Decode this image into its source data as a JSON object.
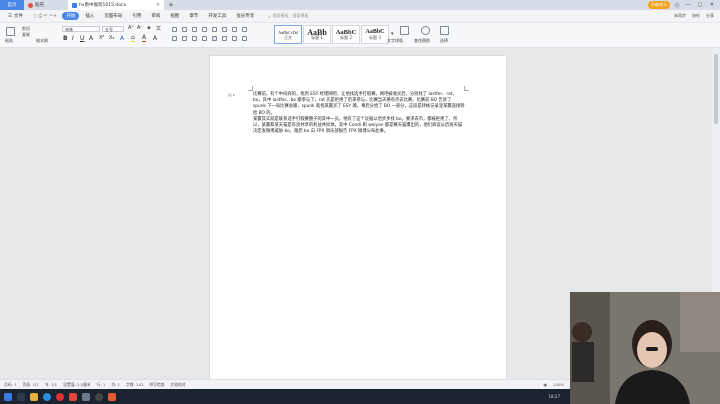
{
  "titlebar": {
    "tabs": [
      {
        "label": "首页"
      },
      {
        "label": "稻壳"
      },
      {
        "label": "hx南中猴狗1015.docx"
      }
    ],
    "upgrade_label": "升级领卡",
    "win_controls": [
      "—",
      "□",
      "✕"
    ]
  },
  "menubar": {
    "file_label": "三 文件",
    "items": [
      "开始",
      "插入",
      "页面布局",
      "引用",
      "审阅",
      "视图",
      "章节",
      "开发工具",
      "会员专享"
    ],
    "active_item": "开始",
    "search_placeholder": "搜索模板、搜索模板",
    "right": [
      "未同步",
      "协作",
      "分享"
    ]
  },
  "ribbon": {
    "paste_label": "粘贴",
    "clip": [
      "剪切",
      "复制",
      "格式刷"
    ],
    "font_name": "宋体",
    "font_size": "五号",
    "styles": [
      {
        "preview": "AaBbCcDd",
        "name": "正文"
      },
      {
        "preview": "AaBb",
        "name": "标题 1"
      },
      {
        "preview": "AaBbC",
        "name": "标题 2"
      },
      {
        "preview": "AaBbC",
        "name": "标题 3"
      }
    ],
    "text_tools": "文字排版",
    "find_replace": "查找替换",
    "select": "选择"
  },
  "document": {
    "paragraphs": [
      "比赛前，有个中间商的，找到 ESY 经理网吧，让他找选手打假赛，网吧被收买后，分别找了 lastfer、rat、bo，其中 lastfer、bo 都参与了，rat 先是拒绝了后来参与，比赛当天猜有点去比赛，比赛前 BO 告诉了 spunk 下一局比赛会输，spunk 就找某赢买了 ESY 输，事后分给了 BO 一部分，这段是转帐记录里某赢直接转给 BO 的。",
      "某赢其实就是联系选手打假赛圈子的其中一员，他有了这个证据以后步步找 bo，要求去市，都被拒绝了，所以，某赢和某天猫是有良共享的利益共同体，其中 Condi 和 weiyan 都是赛天猫爆出的，他们商议以后再天猫决定发微博威胁 bo，随后 bo 向 FPX 俱乐部报告 FPX 微博公布此事。"
    ]
  },
  "statusbar": {
    "left": [
      "页码: 1",
      "页面: 1/1",
      "节: 1/1",
      "设置值: 2.5厘米",
      "行: 1",
      "列: 1",
      "字数: 243",
      "拼写检查",
      "文档校对"
    ],
    "zoom": "100%"
  },
  "taskbar": {
    "time": "18:27"
  }
}
